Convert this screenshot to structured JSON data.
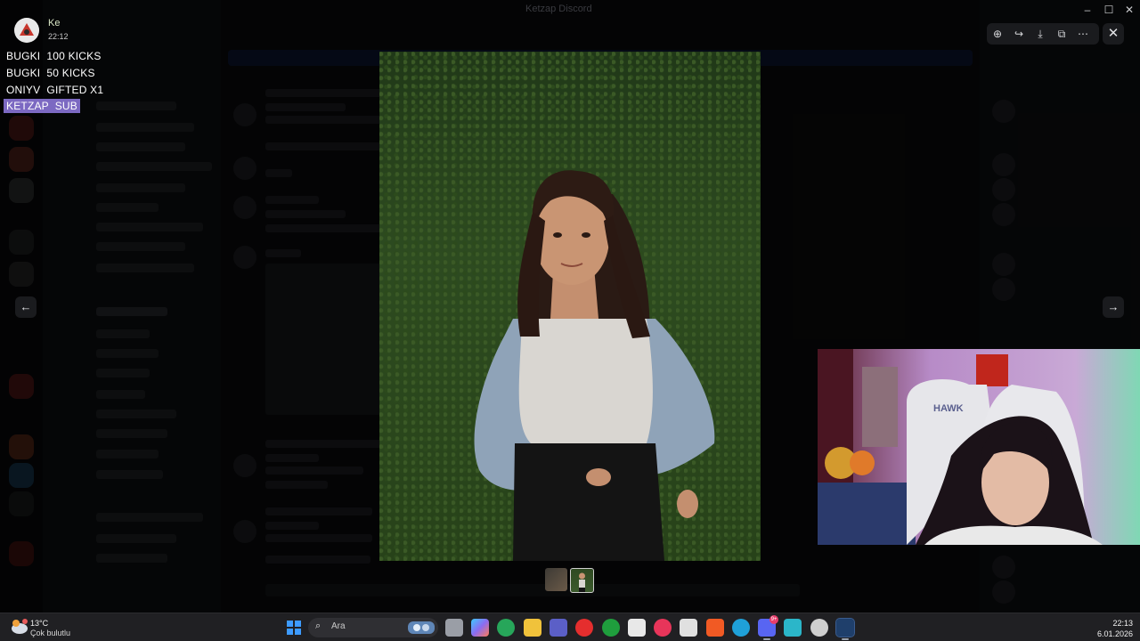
{
  "window": {
    "title": "Ketzap Discord",
    "minimize_glyph": "–",
    "maximize_glyph": "☐",
    "close_glyph": "✕"
  },
  "viewer": {
    "toolbar": [
      {
        "name": "zoom-in-icon",
        "glyph": "⊕"
      },
      {
        "name": "forward-icon",
        "glyph": "↪"
      },
      {
        "name": "download-icon",
        "glyph": "⤓"
      },
      {
        "name": "open-external-icon",
        "glyph": "⧉"
      },
      {
        "name": "more-icon",
        "glyph": "⋯"
      }
    ],
    "close_glyph": "✕",
    "prev_glyph": "←",
    "next_glyph": "→"
  },
  "stream_overlay": {
    "profile_name": "Ke",
    "profile_time": "22:12",
    "alerts": [
      {
        "text": "BUGKI  100 KICKS",
        "highlight": false
      },
      {
        "text": "BUGKI  50 KICKS",
        "highlight": false
      },
      {
        "text": "ONIYV  GIFTED X1",
        "highlight": false
      },
      {
        "text": "KETZAP  SUB",
        "highlight": true
      }
    ]
  },
  "taskbar": {
    "weather_temp": "13°C",
    "weather_desc": "Çok bulutlu",
    "search_placeholder": "Ara",
    "time": "22:13",
    "date": "6.01.2026",
    "discord_badge": "9+",
    "apps": [
      {
        "name": "windows-start-icon",
        "color": "#3d9bff"
      },
      {
        "name": "task-view-icon",
        "color": "#b9bec7"
      },
      {
        "name": "copilot-icon",
        "color": "#8b6cf2"
      },
      {
        "name": "gaming-app-icon",
        "color": "#27a65a"
      },
      {
        "name": "file-explorer-icon",
        "color": "#f0c23b"
      },
      {
        "name": "teams-icon",
        "color": "#5b5fc7"
      },
      {
        "name": "opera-icon",
        "color": "#e52e2e"
      },
      {
        "name": "xbox-icon",
        "color": "#1f9e3d"
      },
      {
        "name": "store-icon",
        "color": "#e8e8e8"
      },
      {
        "name": "media-player-icon",
        "color": "#e8355a"
      },
      {
        "name": "sticky-app-icon",
        "color": "#e0e0e0"
      },
      {
        "name": "brave-icon",
        "color": "#f15a24"
      },
      {
        "name": "edge-icon",
        "color": "#1fa0d8"
      },
      {
        "name": "discord-icon",
        "color": "#5865f2"
      },
      {
        "name": "photos-icon",
        "color": "#2bb6c9"
      },
      {
        "name": "obs-icon",
        "color": "#cfcfcf"
      },
      {
        "name": "steam-icon",
        "color": "#1f3f6b"
      }
    ]
  }
}
